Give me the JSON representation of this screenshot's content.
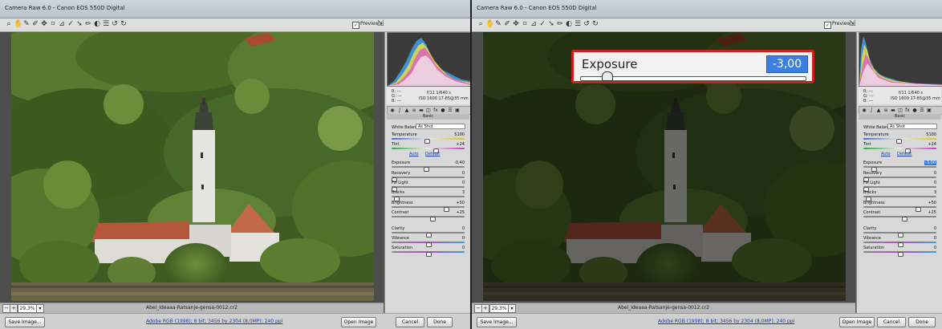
{
  "colors": {
    "callout_border": "#d21d1d",
    "value_highlight": "#3c7fe0",
    "link": "#1a3fa8"
  },
  "left": {
    "title": "Camera Raw 6.0 - Canon EOS 550D Digital",
    "preview_label": "Preview",
    "zoom": "29,3%",
    "filename": "Abel_Ideaaa-Ratsanje-gensa-0012.cr2",
    "readout": {
      "r": "R:  ---",
      "g": "G:  ---",
      "b": "B:  ---",
      "exif1": "f/11    1/640 s",
      "exif2": "ISO 1600    17-85@35 mm"
    },
    "panel_title": "Basic",
    "wb": {
      "label": "White Balance:",
      "value": "As Shot"
    },
    "auto": "Auto",
    "default": "Default",
    "sliders": [
      {
        "label": "Temperature",
        "value": "5100",
        "pos": 0.48,
        "kind": "temp"
      },
      {
        "label": "Tint",
        "value": "+24",
        "pos": 0.6,
        "kind": "tint"
      },
      {
        "label": "Exposure",
        "value": "-0,40",
        "pos": 0.46,
        "kind": ""
      },
      {
        "label": "Recovery",
        "value": "0",
        "pos": 0.0,
        "kind": ""
      },
      {
        "label": "Fill Light",
        "value": "0",
        "pos": 0.0,
        "kind": ""
      },
      {
        "label": "Blacks",
        "value": "3",
        "pos": 0.03,
        "kind": ""
      },
      {
        "label": "Brightness",
        "value": "+50",
        "pos": 0.75,
        "kind": ""
      },
      {
        "label": "Contrast",
        "value": "+25",
        "pos": 0.56,
        "kind": ""
      },
      {
        "label": "Clarity",
        "value": "0",
        "pos": 0.5,
        "kind": ""
      },
      {
        "label": "Vibrance",
        "value": "0",
        "pos": 0.5,
        "kind": "vib"
      },
      {
        "label": "Saturation",
        "value": "0",
        "pos": 0.5,
        "kind": "vib"
      }
    ],
    "save_image": "Save Image...",
    "workflow": "Adobe RGB (1998); 8 bit; 3456 by 2304 (8,0MP); 240 ppi",
    "open_image": "Open Image",
    "cancel": "Cancel",
    "done": "Done"
  },
  "right": {
    "title": "Camera Raw 6.0 - Canon EOS 550D Digital",
    "preview_label": "Preview",
    "zoom": "29,3%",
    "filename": "Abel_Ideaaa-Ratsanje-gensa-0012.cr2",
    "readout": {
      "r": "R:  ---",
      "g": "G:  ---",
      "b": "B:  ---",
      "exif1": "f/11    1/640 s",
      "exif2": "ISO 1600    17-85@35 mm"
    },
    "panel_title": "Basic",
    "wb": {
      "label": "White Balance:",
      "value": "As Shot"
    },
    "auto": "Auto",
    "default": "Default",
    "sliders": [
      {
        "label": "Temperature",
        "value": "5100",
        "pos": 0.48,
        "kind": "temp"
      },
      {
        "label": "Tint",
        "value": "+24",
        "pos": 0.6,
        "kind": "tint"
      },
      {
        "label": "Exposure",
        "value": "-3,00",
        "pos": 0.12,
        "kind": "",
        "selected": true
      },
      {
        "label": "Recovery",
        "value": "0",
        "pos": 0.0,
        "kind": ""
      },
      {
        "label": "Fill Light",
        "value": "0",
        "pos": 0.0,
        "kind": ""
      },
      {
        "label": "Blacks",
        "value": "3",
        "pos": 0.03,
        "kind": ""
      },
      {
        "label": "Brightness",
        "value": "+50",
        "pos": 0.75,
        "kind": ""
      },
      {
        "label": "Contrast",
        "value": "+25",
        "pos": 0.56,
        "kind": ""
      },
      {
        "label": "Clarity",
        "value": "0",
        "pos": 0.5,
        "kind": ""
      },
      {
        "label": "Vibrance",
        "value": "0",
        "pos": 0.5,
        "kind": "vib"
      },
      {
        "label": "Saturation",
        "value": "0",
        "pos": 0.5,
        "kind": "vib"
      }
    ],
    "save_image": "Save Image...",
    "workflow": "Adobe RGB (1998); 8 bit; 3456 by 2304 (8,0MP); 240 ppi",
    "open_image": "Open Image",
    "cancel": "Cancel",
    "done": "Done"
  },
  "callout": {
    "label": "Exposure",
    "value": "-3,00",
    "pos": 0.12
  }
}
